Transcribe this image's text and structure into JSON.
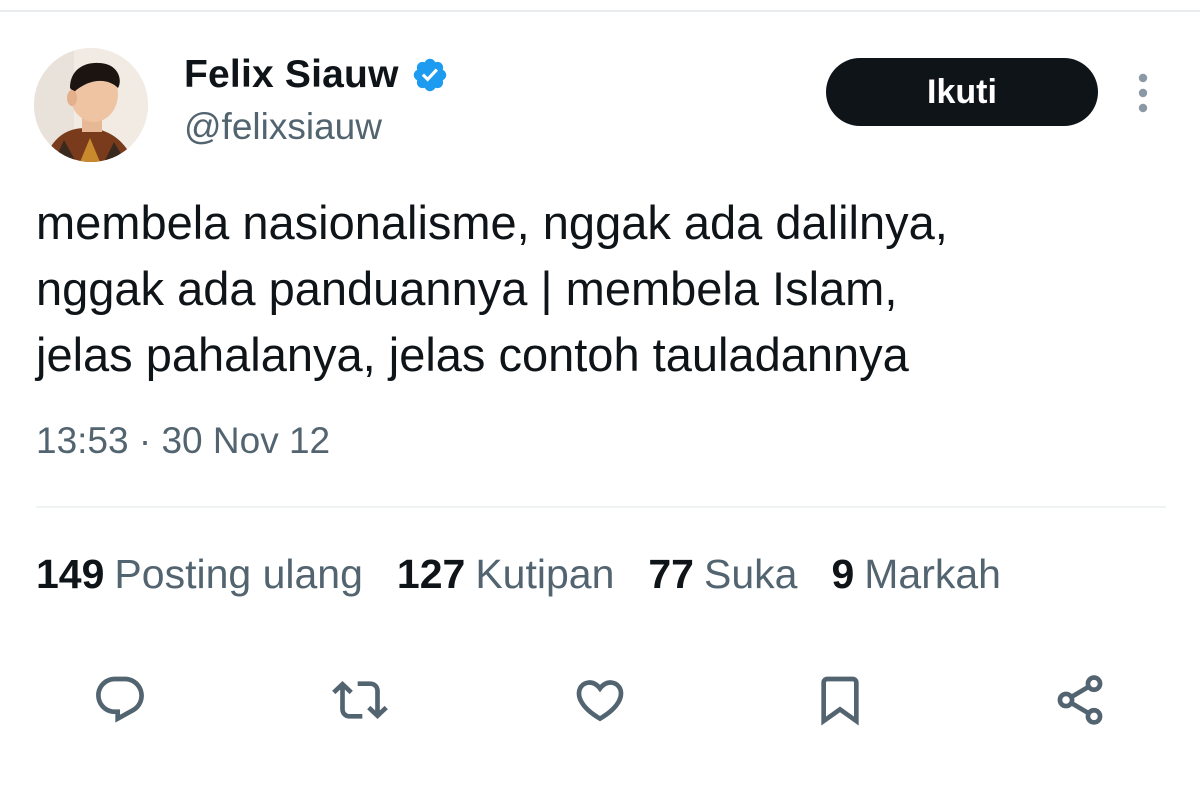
{
  "author": {
    "display_name": "Felix Siauw",
    "handle": "@felixsiauw",
    "verified": true,
    "avatar_icon": "profile-photo"
  },
  "header": {
    "follow_label": "Ikuti",
    "more_icon": "more-vertical-icon"
  },
  "tweet": {
    "lines": [
      "membela nasionalisme, nggak ada dalilnya,",
      "nggak ada panduannya | membela Islam,",
      "jelas pahalanya, jelas contoh tauladannya"
    ],
    "timestamp": "13:53 · 30 Nov 12"
  },
  "stats": [
    {
      "count": "149",
      "label": "Posting ulang"
    },
    {
      "count": "127",
      "label": "Kutipan"
    },
    {
      "count": "77",
      "label": "Suka"
    },
    {
      "count": "9",
      "label": "Markah"
    }
  ],
  "actions": [
    {
      "icon": "reply-icon"
    },
    {
      "icon": "repost-icon"
    },
    {
      "icon": "like-icon"
    },
    {
      "icon": "bookmark-icon"
    },
    {
      "icon": "share-icon"
    }
  ],
  "colors": {
    "primary_text": "#0f1419",
    "secondary_text": "#536471",
    "verified_badge": "#1d9bf0",
    "follow_button_bg": "#0f1419",
    "divider": "#eff3f4"
  }
}
